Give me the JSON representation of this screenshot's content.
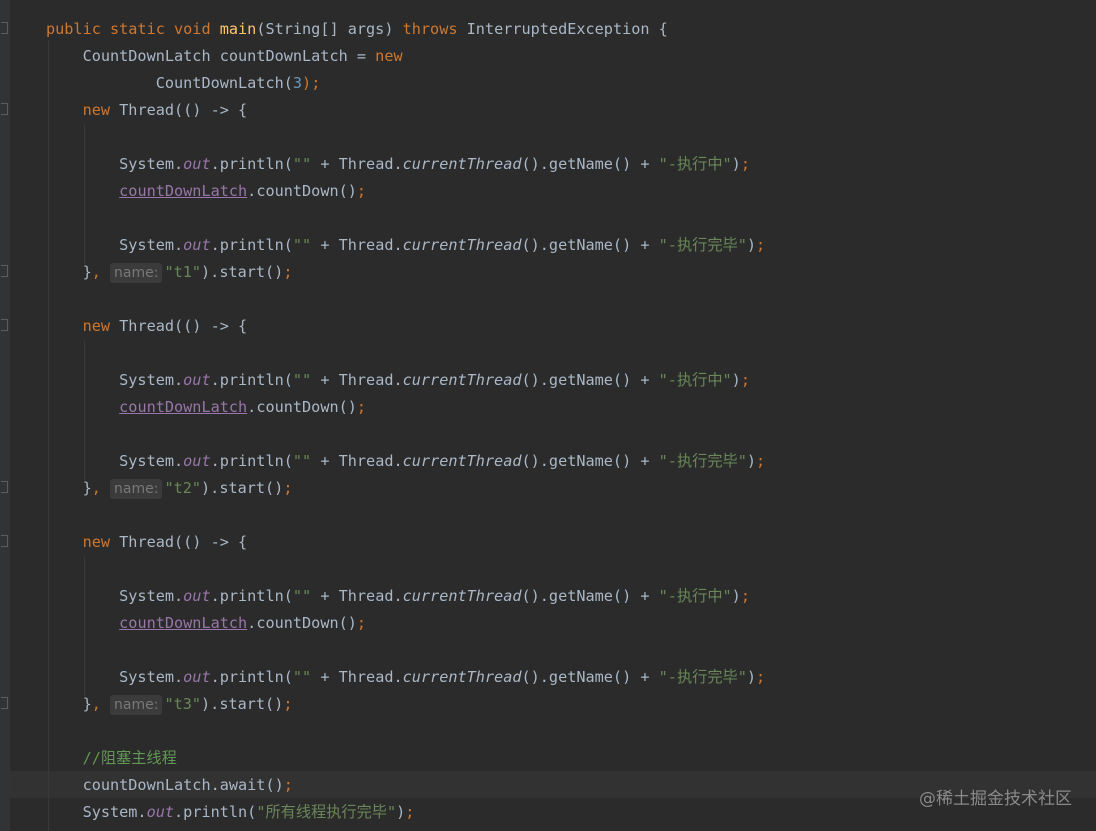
{
  "editor": {
    "lines": [
      [
        [
          "kw",
          "public static void "
        ],
        [
          "fn",
          "main"
        ],
        [
          "",
          "(String[] args) "
        ],
        [
          "kw",
          "throws "
        ],
        [
          "",
          "InterruptedException {"
        ]
      ],
      [
        [
          "",
          "    CountDownLatch countDownLatch = "
        ],
        [
          "kw",
          "new"
        ]
      ],
      [
        [
          "",
          "            CountDownLatch("
        ],
        [
          "num",
          "3"
        ],
        [
          "kw",
          ");"
        ]
      ],
      [
        [
          "kw",
          "    new "
        ],
        [
          "",
          "Thread(() -> {"
        ]
      ],
      [],
      [
        [
          "",
          "        System."
        ],
        [
          "fld",
          "out"
        ],
        [
          "",
          ".println("
        ],
        [
          "str",
          "\"\""
        ],
        [
          "",
          " + Thread."
        ],
        [
          "ital",
          "currentThread"
        ],
        [
          "",
          "().getName() + "
        ],
        [
          "str",
          "\"-执行中\""
        ],
        [
          "",
          ")"
        ],
        [
          "kw",
          ";"
        ]
      ],
      [
        [
          "",
          "        "
        ],
        [
          "var",
          "countDownLatch"
        ],
        [
          "",
          ".countDown()"
        ],
        [
          "kw",
          ";"
        ]
      ],
      [],
      [
        [
          "",
          "        System."
        ],
        [
          "fld",
          "out"
        ],
        [
          "",
          ".println("
        ],
        [
          "str",
          "\"\""
        ],
        [
          "",
          " + Thread."
        ],
        [
          "ital",
          "currentThread"
        ],
        [
          "",
          "().getName() + "
        ],
        [
          "str",
          "\"-执行完毕\""
        ],
        [
          "",
          ")"
        ],
        [
          "kw",
          ";"
        ]
      ],
      [
        [
          "",
          "    }"
        ],
        [
          "kw",
          ","
        ],
        [
          "",
          " "
        ],
        [
          "hint",
          "name:"
        ],
        [
          "str",
          "\"t1\""
        ],
        [
          "",
          ").start()"
        ],
        [
          "kw",
          ";"
        ]
      ],
      [],
      [
        [
          "kw",
          "    new "
        ],
        [
          "",
          "Thread(() -> {"
        ]
      ],
      [],
      [
        [
          "",
          "        System."
        ],
        [
          "fld",
          "out"
        ],
        [
          "",
          ".println("
        ],
        [
          "str",
          "\"\""
        ],
        [
          "",
          " + Thread."
        ],
        [
          "ital",
          "currentThread"
        ],
        [
          "",
          "().getName() + "
        ],
        [
          "str",
          "\"-执行中\""
        ],
        [
          "",
          ")"
        ],
        [
          "kw",
          ";"
        ]
      ],
      [
        [
          "",
          "        "
        ],
        [
          "var",
          "countDownLatch"
        ],
        [
          "",
          ".countDown()"
        ],
        [
          "kw",
          ";"
        ]
      ],
      [],
      [
        [
          "",
          "        System."
        ],
        [
          "fld",
          "out"
        ],
        [
          "",
          ".println("
        ],
        [
          "str",
          "\"\""
        ],
        [
          "",
          " + Thread."
        ],
        [
          "ital",
          "currentThread"
        ],
        [
          "",
          "().getName() + "
        ],
        [
          "str",
          "\"-执行完毕\""
        ],
        [
          "",
          ")"
        ],
        [
          "kw",
          ";"
        ]
      ],
      [
        [
          "",
          "    }"
        ],
        [
          "kw",
          ","
        ],
        [
          "",
          " "
        ],
        [
          "hint",
          "name:"
        ],
        [
          "str",
          "\"t2\""
        ],
        [
          "",
          ").start()"
        ],
        [
          "kw",
          ";"
        ]
      ],
      [],
      [
        [
          "kw",
          "    new "
        ],
        [
          "",
          "Thread(() -> {"
        ]
      ],
      [],
      [
        [
          "",
          "        System."
        ],
        [
          "fld",
          "out"
        ],
        [
          "",
          ".println("
        ],
        [
          "str",
          "\"\""
        ],
        [
          "",
          " + Thread."
        ],
        [
          "ital",
          "currentThread"
        ],
        [
          "",
          "().getName() + "
        ],
        [
          "str",
          "\"-执行中\""
        ],
        [
          "",
          ")"
        ],
        [
          "kw",
          ";"
        ]
      ],
      [
        [
          "",
          "        "
        ],
        [
          "var",
          "countDownLatch"
        ],
        [
          "",
          ".countDown()"
        ],
        [
          "kw",
          ";"
        ]
      ],
      [],
      [
        [
          "",
          "        System."
        ],
        [
          "fld",
          "out"
        ],
        [
          "",
          ".println("
        ],
        [
          "str",
          "\"\""
        ],
        [
          "",
          " + Thread."
        ],
        [
          "ital",
          "currentThread"
        ],
        [
          "",
          "().getName() + "
        ],
        [
          "str",
          "\"-执行完毕\""
        ],
        [
          "",
          ")"
        ],
        [
          "kw",
          ";"
        ]
      ],
      [
        [
          "",
          "    }"
        ],
        [
          "kw",
          ","
        ],
        [
          "",
          " "
        ],
        [
          "hint",
          "name:"
        ],
        [
          "str",
          "\"t3\""
        ],
        [
          "",
          ").start()"
        ],
        [
          "kw",
          ";"
        ]
      ],
      [],
      [
        [
          "cmt",
          "    //阻塞主线程"
        ]
      ],
      [
        [
          "",
          "    countDownLatch.await()"
        ],
        [
          "kw",
          ";"
        ]
      ],
      [
        [
          "",
          "    System."
        ],
        [
          "fld",
          "out"
        ],
        [
          "",
          ".println("
        ],
        [
          "str",
          "\"所有线程执行完毕\""
        ],
        [
          "",
          ")"
        ],
        [
          "kw",
          ";"
        ]
      ]
    ]
  },
  "watermark": "@稀土掘金技术社区",
  "colors": {
    "background": "#2b2b2b",
    "keyword": "#cc7832",
    "method_decl": "#ffc66d",
    "number": "#6897bb",
    "string": "#6a8759",
    "field": "#9876aa",
    "comment": "#629755",
    "default_text": "#a9b7c6"
  }
}
